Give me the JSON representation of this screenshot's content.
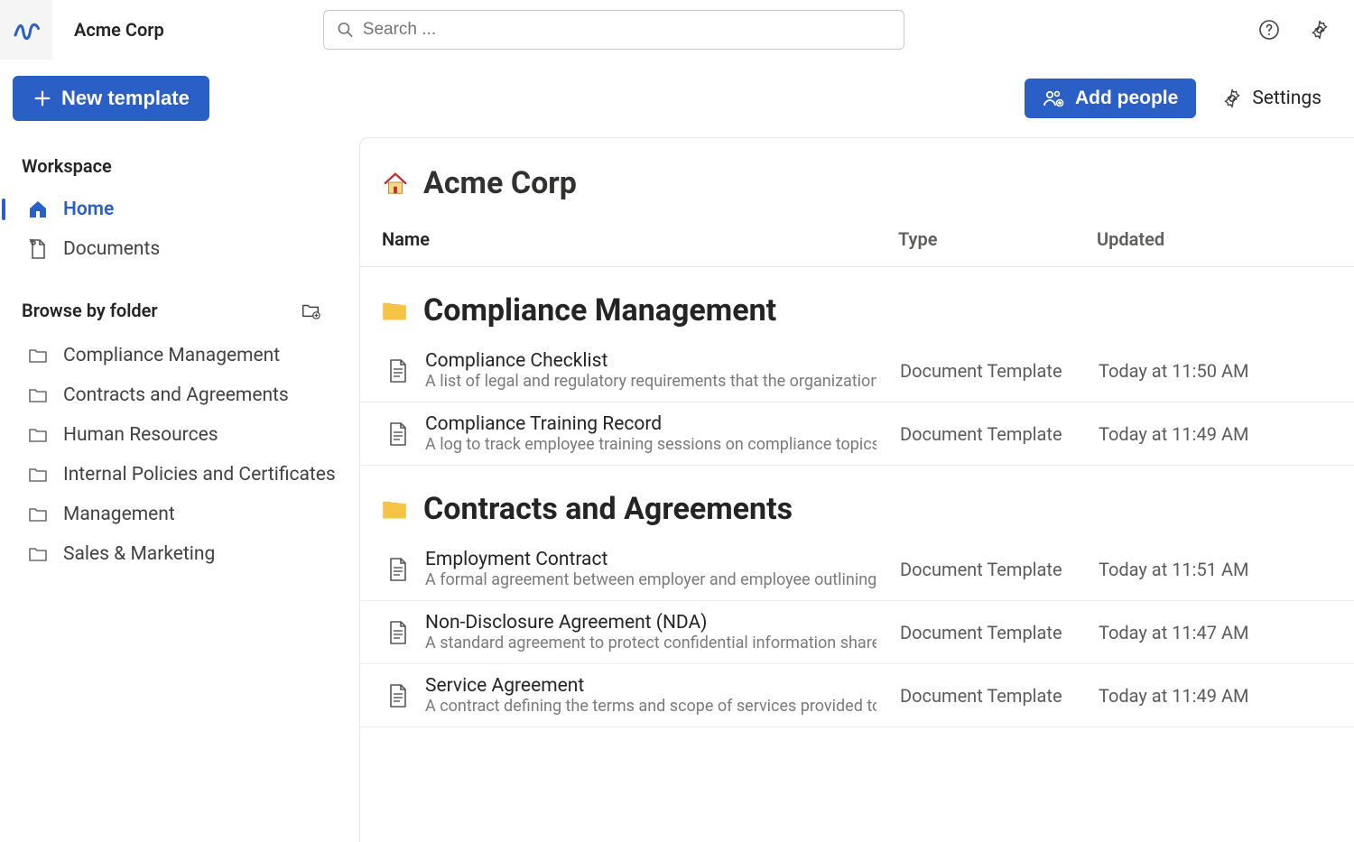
{
  "org": {
    "name": "Acme Corp"
  },
  "search": {
    "placeholder": "Search ..."
  },
  "sidebar": {
    "new_template_label": "New template",
    "workspace_label": "Workspace",
    "nav": [
      {
        "label": "Home",
        "active": true,
        "icon": "home"
      },
      {
        "label": "Documents",
        "active": false,
        "icon": "documents"
      }
    ],
    "browse_label": "Browse by folder",
    "folders": [
      {
        "label": "Compliance Management"
      },
      {
        "label": "Contracts and Agreements"
      },
      {
        "label": "Human Resources"
      },
      {
        "label": "Internal Policies and Certificates"
      },
      {
        "label": "Management"
      },
      {
        "label": "Sales & Marketing"
      }
    ]
  },
  "main": {
    "add_people_label": "Add people",
    "settings_label": "Settings",
    "title": "Acme Corp",
    "columns": {
      "name": "Name",
      "type": "Type",
      "updated": "Updated"
    },
    "sections": [
      {
        "title": "Compliance Management",
        "rows": [
          {
            "title": "Compliance Checklist",
            "desc": "A list of legal and regulatory requirements that the organization mu",
            "type": "Document Template",
            "updated": "Today at 11:50 AM"
          },
          {
            "title": "Compliance Training Record",
            "desc": "A log to track employee training sessions on compliance topics.",
            "type": "Document Template",
            "updated": "Today at 11:49 AM"
          }
        ]
      },
      {
        "title": "Contracts and Agreements",
        "rows": [
          {
            "title": "Employment Contract",
            "desc": "A formal agreement between employer and employee outlining rol",
            "type": "Document Template",
            "updated": "Today at 11:51 AM"
          },
          {
            "title": "Non-Disclosure Agreement (NDA)",
            "desc": "A standard agreement to protect confidential information shared b",
            "type": "Document Template",
            "updated": "Today at 11:47 AM"
          },
          {
            "title": "Service Agreement",
            "desc": "A contract defining the terms and scope of services provided to ou",
            "type": "Document Template",
            "updated": "Today at 11:49 AM"
          }
        ]
      }
    ]
  }
}
